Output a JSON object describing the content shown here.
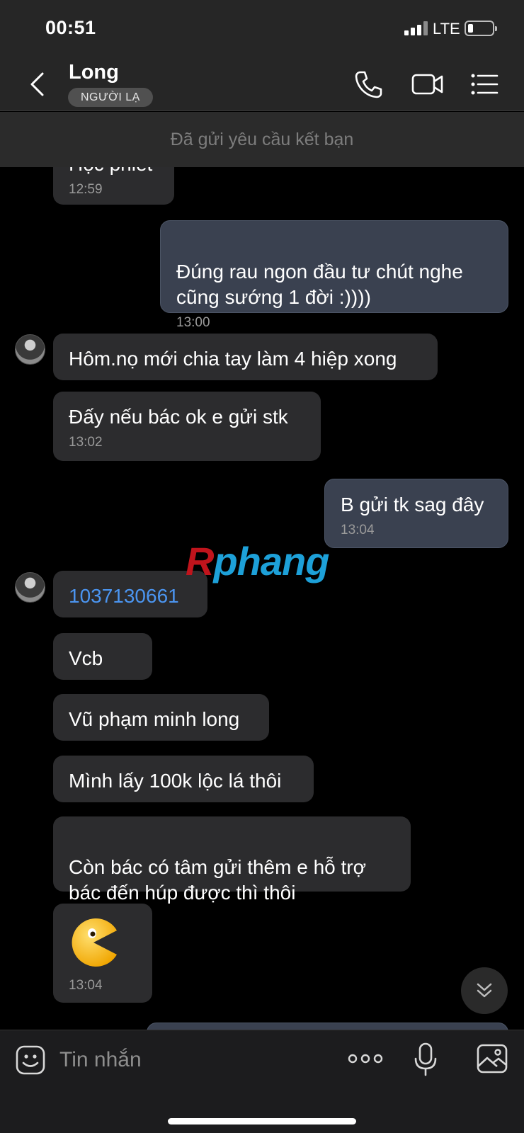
{
  "status_bar": {
    "time": "00:51",
    "network": "LTE",
    "battery_level": 0.2
  },
  "header": {
    "contact_name": "Long",
    "badge": "NGƯỜI LẠ",
    "icons": [
      "back-icon",
      "phone-icon",
      "video-call-icon",
      "menu-list-icon"
    ]
  },
  "banner": {
    "text": "Đã gửi yêu cầu kết bạn"
  },
  "messages": [
    {
      "direction": "in",
      "text": "Học phiết",
      "time": "12:59"
    },
    {
      "direction": "out",
      "text": "Đúng rau ngon đầu tư chút nghe\ncũng sướng 1 đời :))))",
      "time": "13:00"
    },
    {
      "direction": "in",
      "text": "Hôm.nọ mới chia tay làm 4 hiệp xong",
      "time": ""
    },
    {
      "direction": "in",
      "text": "Đấy nếu bác ok e gửi stk",
      "time": "13:02"
    },
    {
      "direction": "out",
      "text": "B gửi tk sag đây",
      "time": "13:04"
    },
    {
      "direction": "in",
      "text": "1037130661",
      "time": ""
    },
    {
      "direction": "in",
      "text": "Vcb",
      "time": ""
    },
    {
      "direction": "in",
      "text": "Vũ phạm minh long",
      "time": ""
    },
    {
      "direction": "in",
      "text": "Mình lấy 100k lộc lá thôi",
      "time": ""
    },
    {
      "direction": "in",
      "text": "Còn bác có tâm gửi thêm e hỗ trợ\nbác đến húp được thì thôi",
      "time": ""
    },
    {
      "direction": "in",
      "sticker": "pacman-sticker",
      "time": "13:04"
    }
  ],
  "watermark": {
    "first": "R",
    "rest": "phang"
  },
  "composer": {
    "placeholder": "Tin nhắn",
    "icons": [
      "sticker-icon",
      "more-icon",
      "microphone-icon",
      "image-icon"
    ]
  },
  "colors": {
    "outgoing_bubble": "#3a4150",
    "incoming_bubble": "#2c2c2e",
    "link": "#4b95f0"
  }
}
